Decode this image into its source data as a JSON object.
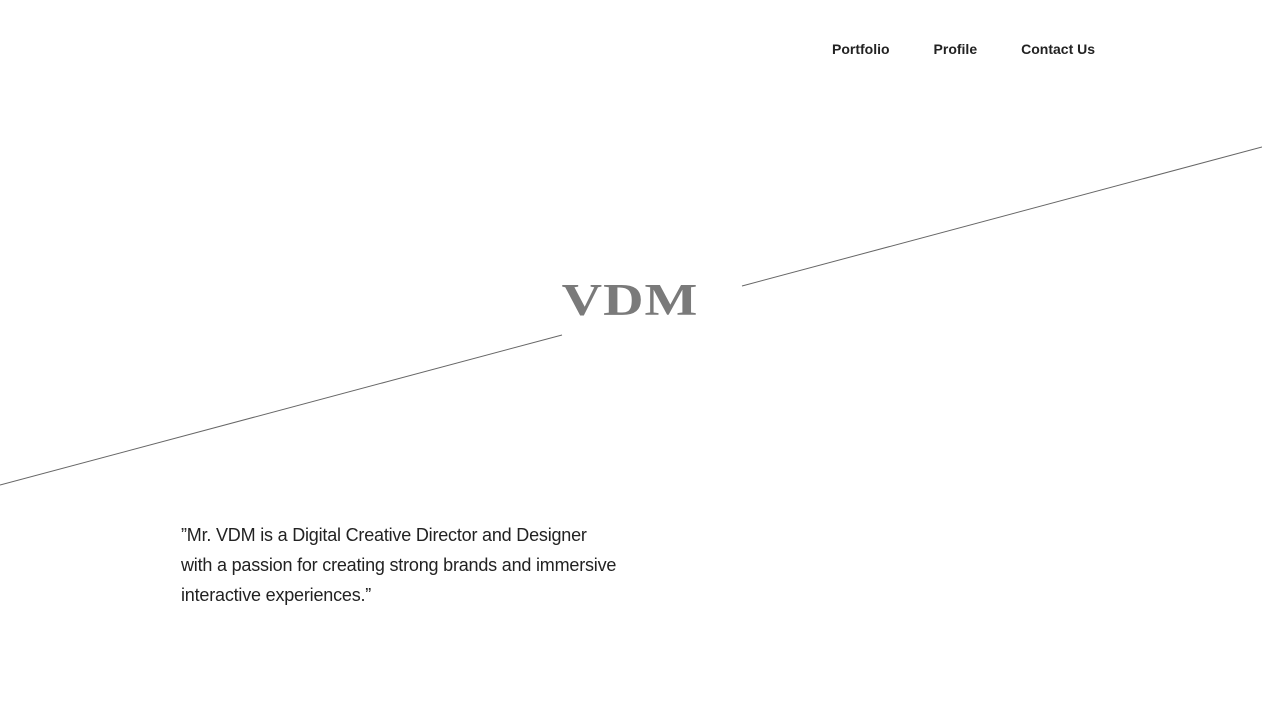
{
  "nav": {
    "items": [
      {
        "label": "Portfolio"
      },
      {
        "label": "Profile"
      },
      {
        "label": "Contact Us"
      }
    ]
  },
  "hero": {
    "logo_text": "VDM",
    "logo_color": "#7a7a7a",
    "line_color": "#666666"
  },
  "quote": {
    "text": "”Mr. VDM is a Digital Creative Director and Designer with a passion for creating strong brands and immersive interactive experiences.”"
  }
}
